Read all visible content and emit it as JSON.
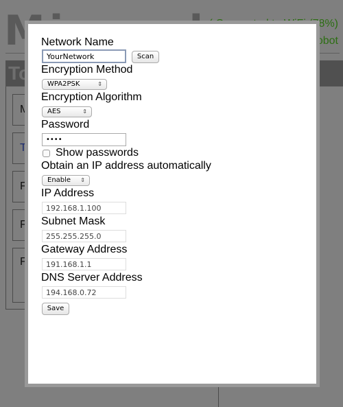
{
  "background": {
    "logo": "Miroool",
    "status": "( Connected to WiFi (78%)",
    "status_sub": "obot",
    "section_title": "To",
    "panel_letters": [
      "M",
      "T",
      "F",
      "F",
      "F"
    ]
  },
  "dialog": {
    "network_name_label": "Network Name",
    "network_name_value": "YourNetwork",
    "scan_label": "Scan",
    "encryption_method_label": "Encryption Method",
    "encryption_method_value": "WPA2PSK",
    "encryption_algorithm_label": "Encryption Algorithm",
    "encryption_algorithm_value": "AES",
    "password_label": "Password",
    "password_value": "••••",
    "show_passwords_label": "Show passwords",
    "show_passwords_checked": false,
    "dhcp_label": "Obtain an IP address automatically",
    "dhcp_value": "Enable",
    "ip_label": "IP Address",
    "ip_value": "192.168.1.100",
    "subnet_label": "Subnet Mask",
    "subnet_value": "255.255.255.0",
    "gateway_label": "Gateway Address",
    "gateway_value": "191.168.1.1",
    "dns_label": "DNS Server Address",
    "dns_value": "194.168.0.72",
    "save_label": "Save"
  }
}
